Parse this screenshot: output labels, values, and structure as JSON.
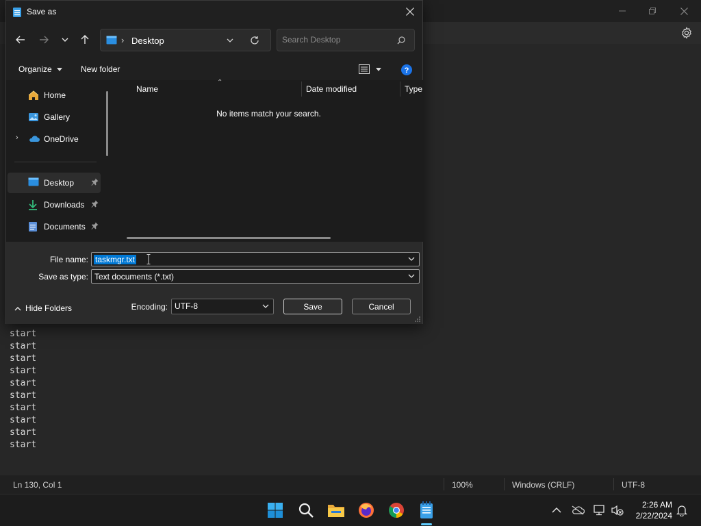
{
  "notepad": {
    "lines": [
      "start",
      "start",
      "start",
      "start",
      "start",
      "start",
      "start",
      "start",
      "start",
      "start",
      "start"
    ],
    "status": {
      "position": "Ln 130, Col 1",
      "zoom": "100%",
      "line_ending": "Windows (CRLF)",
      "encoding": "UTF-8"
    }
  },
  "dialog": {
    "title": "Save as",
    "address": {
      "location": "Desktop"
    },
    "search": {
      "placeholder": "Search Desktop"
    },
    "commands": {
      "organize": "Organize",
      "new_folder": "New folder"
    },
    "nav_items": [
      {
        "label": "Home",
        "icon": "home-icon",
        "pinned": false
      },
      {
        "label": "Gallery",
        "icon": "gallery-icon",
        "pinned": false
      },
      {
        "label": "OneDrive",
        "icon": "onedrive-icon",
        "pinned": false
      },
      {
        "label": "Desktop",
        "icon": "desktop-icon",
        "pinned": true,
        "selected": true
      },
      {
        "label": "Downloads",
        "icon": "downloads-icon",
        "pinned": true
      },
      {
        "label": "Documents",
        "icon": "documents-icon",
        "pinned": true
      }
    ],
    "columns": {
      "name": "Name",
      "date_modified": "Date modified",
      "type": "Type"
    },
    "empty_message": "No items match your search.",
    "form": {
      "file_name_label": "File name:",
      "file_name_value": "taskmgr.txt",
      "save_as_type_label": "Save as type:",
      "save_as_type_value": "Text documents (*.txt)",
      "encoding_label": "Encoding:",
      "encoding_value": "UTF-8",
      "save_label": "Save",
      "cancel_label": "Cancel",
      "hide_folders_label": "Hide Folders"
    }
  },
  "taskbar": {
    "time": "2:26 AM",
    "date": "2/22/2024"
  },
  "colors": {
    "accent": "#60cdff",
    "selection": "#0078d4",
    "folder": "#f1c232",
    "onedrive": "#3a96dd"
  }
}
